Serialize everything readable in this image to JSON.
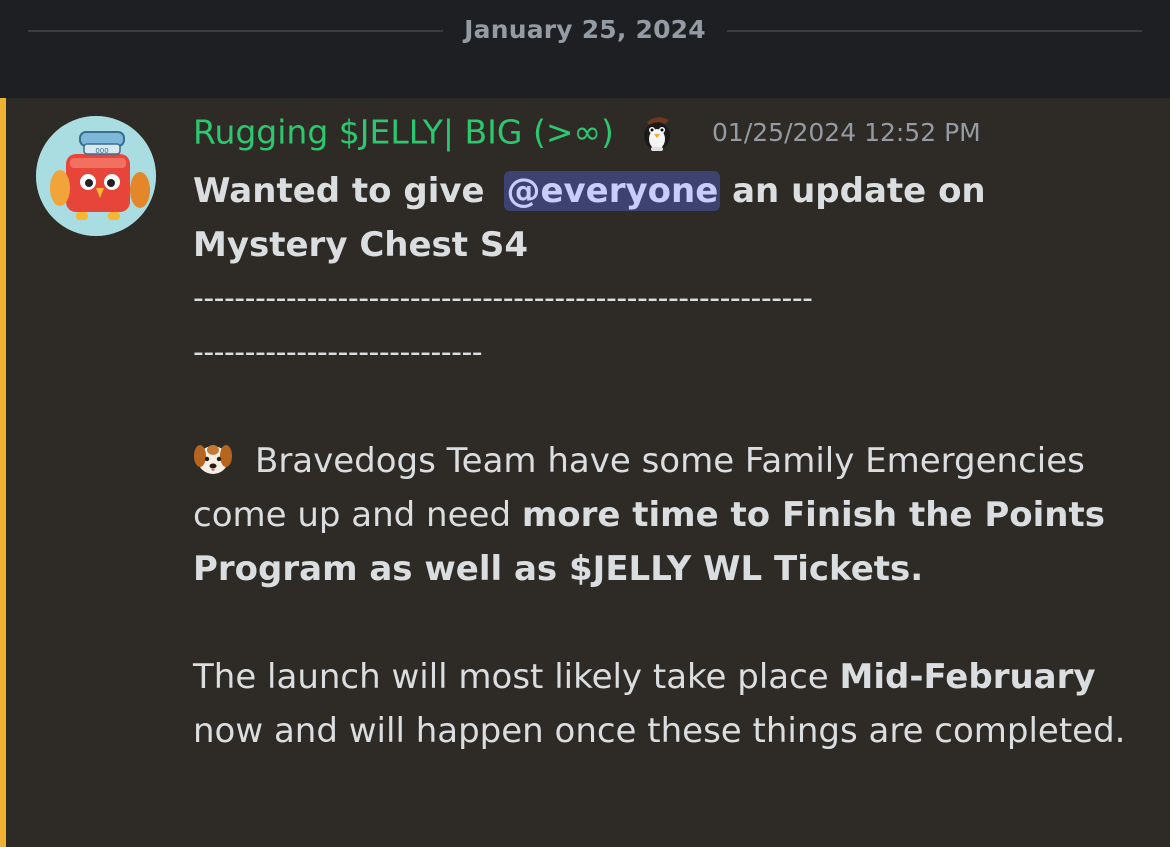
{
  "date_divider": {
    "text": "January 25, 2024"
  },
  "message": {
    "accent_color": "#f0b232",
    "author": {
      "name": "Rugging $JELLY| BIG (>∞)",
      "name_color": "#2dc770",
      "avatar_icon": "jelly-jar-avatar",
      "badge_icon": "penguin-badge-icon"
    },
    "timestamp": "01/25/2024 12:52 PM",
    "headline": {
      "before": "Wanted to give ",
      "mention": "@everyone",
      "after": " an update on Mystery Chest S4"
    },
    "separator_line_1": "------------------------------------------------------------",
    "separator_line_2": "----------------------------",
    "paragraph1": {
      "emoji_icon": "dog-face-icon",
      "text_normal": "Bravedogs Team have some Family Emergencies come up and need ",
      "text_bold": "more time to Finish the Points Program as well as $JELLY WL Tickets."
    },
    "paragraph2": {
      "text_before": "The launch will most likely take place ",
      "text_bold": "Mid-February",
      "text_after": " now and will happen once these things are completed."
    }
  }
}
